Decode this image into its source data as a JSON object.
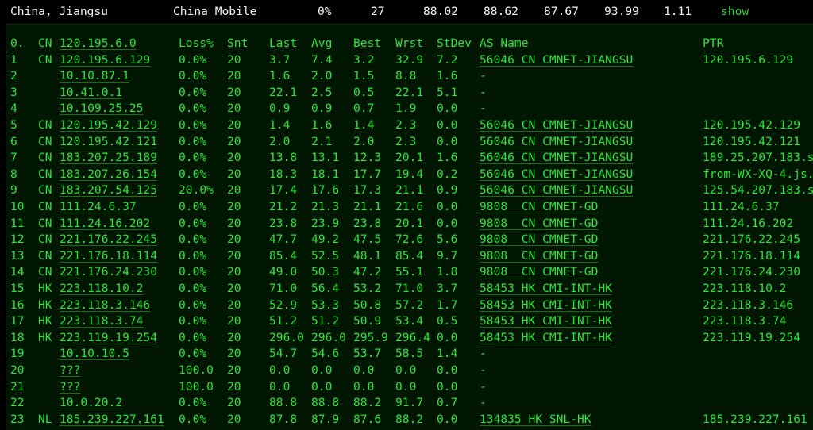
{
  "topbar": {
    "location": "China, Jiangsu",
    "isp": "China Mobile",
    "loss": "0%",
    "hops": "27",
    "v1": "88.02",
    "v2": "88.62",
    "v3": "87.67",
    "v4": "93.99",
    "v5": "1.11",
    "show_label": "show"
  },
  "colors": {
    "text": "#2ee33a",
    "background": "#011701",
    "topbar": "#000000"
  },
  "header": [
    "0.",
    "CN",
    "120.195.6.0",
    "Loss%",
    "Snt",
    "Last",
    "Avg",
    "Best",
    "Wrst",
    "StDev",
    "AS Name",
    "PTR"
  ],
  "rows": [
    [
      "1",
      "CN",
      "120.195.6.129",
      "0.0%",
      "20",
      "3.7",
      "7.4",
      "3.2",
      "32.9",
      "7.2",
      "56046 CN CMNET-JIANGSU",
      "120.195.6.129"
    ],
    [
      "2",
      "",
      "10.10.87.1",
      "0.0%",
      "20",
      "1.6",
      "2.0",
      "1.5",
      "8.8",
      "1.6",
      "-",
      ""
    ],
    [
      "3",
      "",
      "10.41.0.1",
      "0.0%",
      "20",
      "22.1",
      "2.5",
      "0.5",
      "22.1",
      "5.1",
      "-",
      ""
    ],
    [
      "4",
      "",
      "10.109.25.25",
      "0.0%",
      "20",
      "0.9",
      "0.9",
      "0.7",
      "1.9",
      "0.0",
      "-",
      ""
    ],
    [
      "5",
      "CN",
      "120.195.42.129",
      "0.0%",
      "20",
      "1.4",
      "1.6",
      "1.4",
      "2.3",
      "0.0",
      "56046 CN CMNET-JIANGSU",
      "120.195.42.129"
    ],
    [
      "6",
      "CN",
      "120.195.42.121",
      "0.0%",
      "20",
      "2.0",
      "2.1",
      "2.0",
      "2.3",
      "0.0",
      "56046 CN CMNET-JIANGSU",
      "120.195.42.121"
    ],
    [
      "7",
      "CN",
      "183.207.25.189",
      "0.0%",
      "20",
      "13.8",
      "13.1",
      "12.3",
      "20.1",
      "1.6",
      "56046 CN CMNET-JIANGSU",
      "189.25.207.183.s"
    ],
    [
      "8",
      "CN",
      "183.207.26.154",
      "0.0%",
      "20",
      "18.3",
      "18.1",
      "17.7",
      "19.4",
      "0.2",
      "56046 CN CMNET-JIANGSU",
      "from-WX-XQ-4.js."
    ],
    [
      "9",
      "CN",
      "183.207.54.125",
      "20.0%",
      "20",
      "17.4",
      "17.6",
      "17.3",
      "21.1",
      "0.9",
      "56046 CN CMNET-JIANGSU",
      "125.54.207.183.s"
    ],
    [
      "10",
      "CN",
      "111.24.6.37",
      "0.0%",
      "20",
      "21.2",
      "21.3",
      "21.1",
      "21.6",
      "0.0",
      "9808  CN CMNET-GD",
      "111.24.6.37"
    ],
    [
      "11",
      "CN",
      "111.24.16.202",
      "0.0%",
      "20",
      "23.8",
      "23.9",
      "23.8",
      "20.1",
      "0.0",
      "9808  CN CMNET-GD",
      "111.24.16.202"
    ],
    [
      "12",
      "CN",
      "221.176.22.245",
      "0.0%",
      "20",
      "47.7",
      "49.2",
      "47.5",
      "72.6",
      "5.6",
      "9808  CN CMNET-GD",
      "221.176.22.245"
    ],
    [
      "13",
      "CN",
      "221.176.18.114",
      "0.0%",
      "20",
      "85.4",
      "52.5",
      "48.1",
      "85.4",
      "9.7",
      "9808  CN CMNET-GD",
      "221.176.18.114"
    ],
    [
      "14",
      "CN",
      "221.176.24.230",
      "0.0%",
      "20",
      "49.0",
      "50.3",
      "47.2",
      "55.1",
      "1.8",
      "9808  CN CMNET-GD",
      "221.176.24.230"
    ],
    [
      "15",
      "HK",
      "223.118.10.2",
      "0.0%",
      "20",
      "71.0",
      "56.4",
      "53.2",
      "71.0",
      "3.7",
      "58453 HK CMI-INT-HK",
      "223.118.10.2"
    ],
    [
      "16",
      "HK",
      "223.118.3.146",
      "0.0%",
      "20",
      "52.9",
      "53.3",
      "50.8",
      "57.2",
      "1.7",
      "58453 HK CMI-INT-HK",
      "223.118.3.146"
    ],
    [
      "17",
      "HK",
      "223.118.3.74",
      "0.0%",
      "20",
      "51.2",
      "51.2",
      "50.9",
      "53.4",
      "0.5",
      "58453 HK CMI-INT-HK",
      "223.118.3.74"
    ],
    [
      "18",
      "HK",
      "223.119.19.254",
      "0.0%",
      "20",
      "296.0",
      "296.0",
      "295.9",
      "296.4",
      "0.0",
      "58453 HK CMI-INT-HK",
      "223.119.19.254"
    ],
    [
      "19",
      "",
      "10.10.10.5",
      "0.0%",
      "20",
      "54.7",
      "54.6",
      "53.7",
      "58.5",
      "1.4",
      "-",
      ""
    ],
    [
      "20",
      "",
      "???",
      "100.0",
      "20",
      "0.0",
      "0.0",
      "0.0",
      "0.0",
      "0.0",
      "-",
      ""
    ],
    [
      "21",
      "",
      "???",
      "100.0",
      "20",
      "0.0",
      "0.0",
      "0.0",
      "0.0",
      "0.0",
      "-",
      ""
    ],
    [
      "22",
      "",
      "10.0.20.2",
      "0.0%",
      "20",
      "88.8",
      "88.8",
      "88.2",
      "91.7",
      "0.7",
      "-",
      ""
    ],
    [
      "23",
      "NL",
      "185.239.227.161",
      "0.0%",
      "20",
      "87.8",
      "87.9",
      "87.6",
      "88.2",
      "0.0",
      "134835 HK SNL-HK",
      "185.239.227.161"
    ]
  ]
}
